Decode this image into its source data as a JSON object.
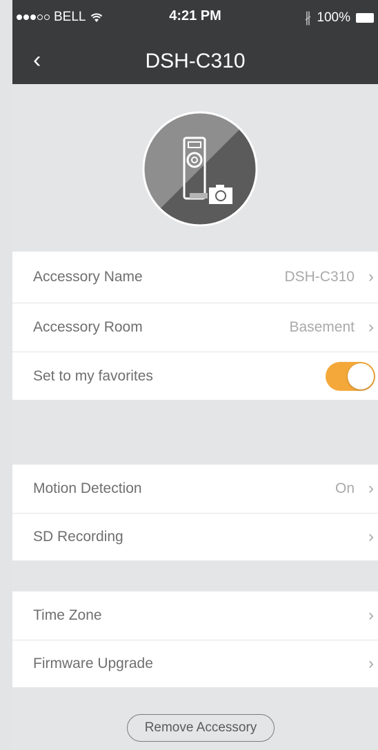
{
  "status_bar": {
    "carrier": "BELL",
    "time": "4:21 PM",
    "battery": "100%"
  },
  "nav": {
    "back_icon": "‹",
    "title": "DSH-C310"
  },
  "device_section": {
    "rows": [
      {
        "label": "Accessory Name",
        "value": "DSH-C310"
      },
      {
        "label": "Accessory Room",
        "value": "Basement"
      }
    ],
    "favorites": {
      "label": "Set to my favorites",
      "enabled": true
    }
  },
  "camera_section": {
    "rows": [
      {
        "label": "Motion Detection",
        "value": "On"
      },
      {
        "label": "SD Recording",
        "value": ""
      }
    ]
  },
  "system_section": {
    "rows": [
      {
        "label": "Time Zone",
        "value": ""
      },
      {
        "label": "Firmware Upgrade",
        "value": ""
      }
    ]
  },
  "remove_button": {
    "label": "Remove Accessory"
  },
  "icons": {
    "chevron": "›",
    "bluetooth": "∦"
  },
  "colors": {
    "nav_background": "#3a3b3d",
    "toggle_on": "#f4a83a"
  }
}
